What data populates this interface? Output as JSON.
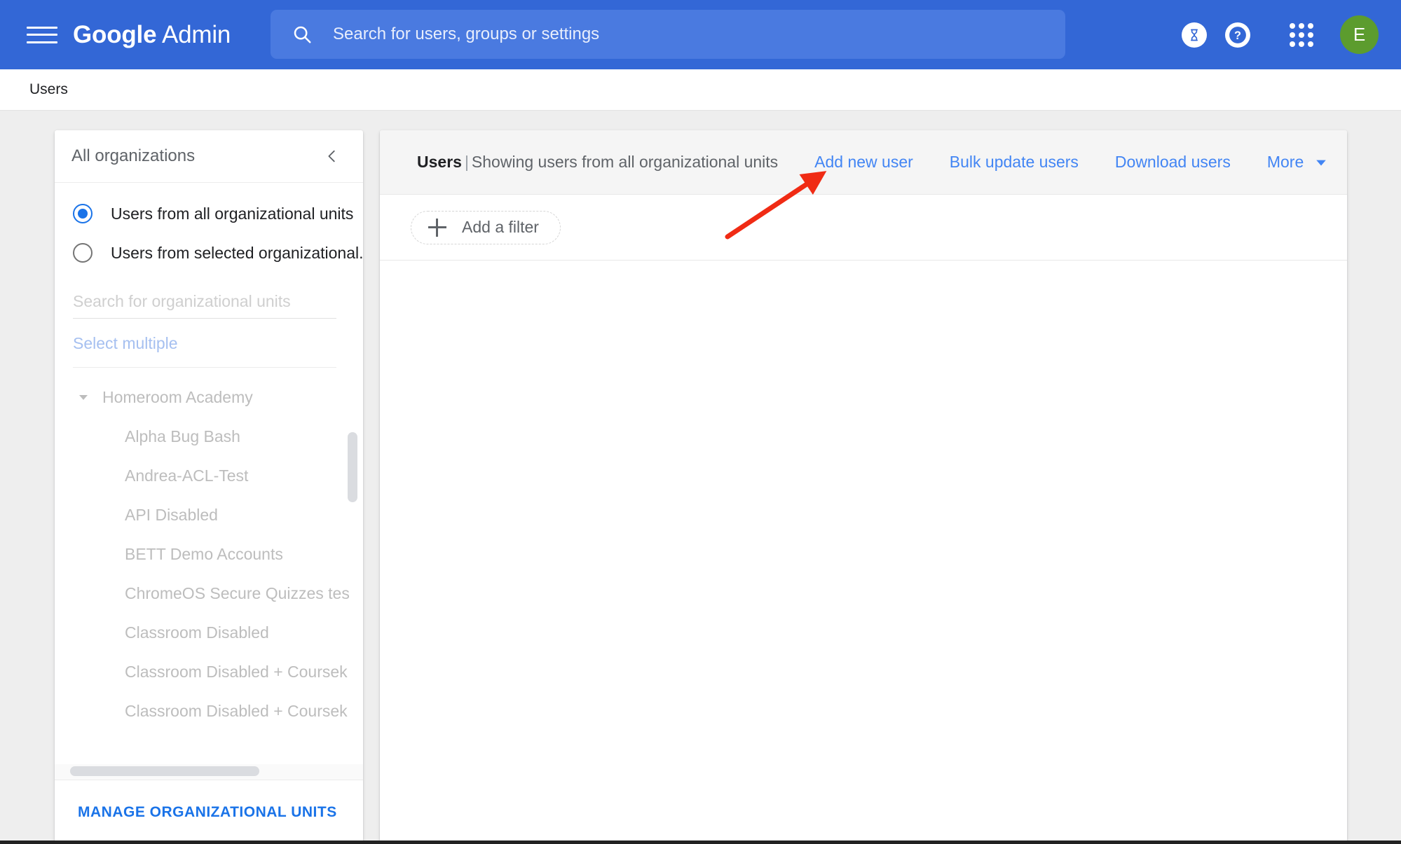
{
  "topbar": {
    "menu_icon": "hamburger-menu-icon",
    "brand_bold": "Google",
    "brand_light": "Admin",
    "search": {
      "icon": "search-icon",
      "placeholder": "Search for users, groups or settings",
      "value": ""
    },
    "icons": {
      "pending": "hourglass-icon",
      "help": "help-question-icon",
      "apps": "apps-grid-icon"
    },
    "avatar_letter": "E",
    "avatar_color": "#5c9c2e",
    "background_color": "#3367d6"
  },
  "breadcrumb": {
    "current": "Users"
  },
  "org_panel": {
    "title": "All organizations",
    "collapse_icon": "chevron-left-icon",
    "scope_options": [
      {
        "label": "Users from all organizational units",
        "selected": true
      },
      {
        "label": "Users from selected organizational...",
        "selected": false
      }
    ],
    "search_placeholder": "Search for organizational units",
    "search_value": "",
    "select_multiple_label": "Select multiple",
    "tree": [
      {
        "label": "Homeroom Academy",
        "level": 0,
        "caret": "caret-down-icon"
      },
      {
        "label": "Alpha Bug Bash",
        "level": 1
      },
      {
        "label": "Andrea-ACL-Test",
        "level": 1
      },
      {
        "label": "API Disabled",
        "level": 1
      },
      {
        "label": "BETT Demo Accounts",
        "level": 1
      },
      {
        "label": "ChromeOS Secure Quizzes tes",
        "level": 1
      },
      {
        "label": "Classroom Disabled",
        "level": 1
      },
      {
        "label": "Classroom Disabled + Coursek",
        "level": 1
      },
      {
        "label": "Classroom Disabled + Coursek",
        "level": 1
      }
    ],
    "manage_button": "MANAGE ORGANIZATIONAL UNITS"
  },
  "main": {
    "title_bold": "Users",
    "title_separator": "|",
    "title_rest": "Showing users from all organizational units",
    "actions": [
      {
        "label": "Add new user",
        "name": "add-new-user-link"
      },
      {
        "label": "Bulk update users",
        "name": "bulk-update-users-link"
      },
      {
        "label": "Download users",
        "name": "download-users-link"
      },
      {
        "label": "More",
        "name": "more-link",
        "caret": "caret-down-icon"
      }
    ],
    "filter_chip": {
      "icon": "plus-icon",
      "label": "Add a filter"
    }
  },
  "annotation": {
    "type": "arrow",
    "color": "#f02b14",
    "points_to": "add-new-user-link"
  },
  "colors": {
    "brand_blue": "#3367d6",
    "link_blue": "#4285f4",
    "accent_blue": "#1a73e8",
    "page_bg": "#eeeeee",
    "card_header_bg": "#f5f5f5"
  }
}
